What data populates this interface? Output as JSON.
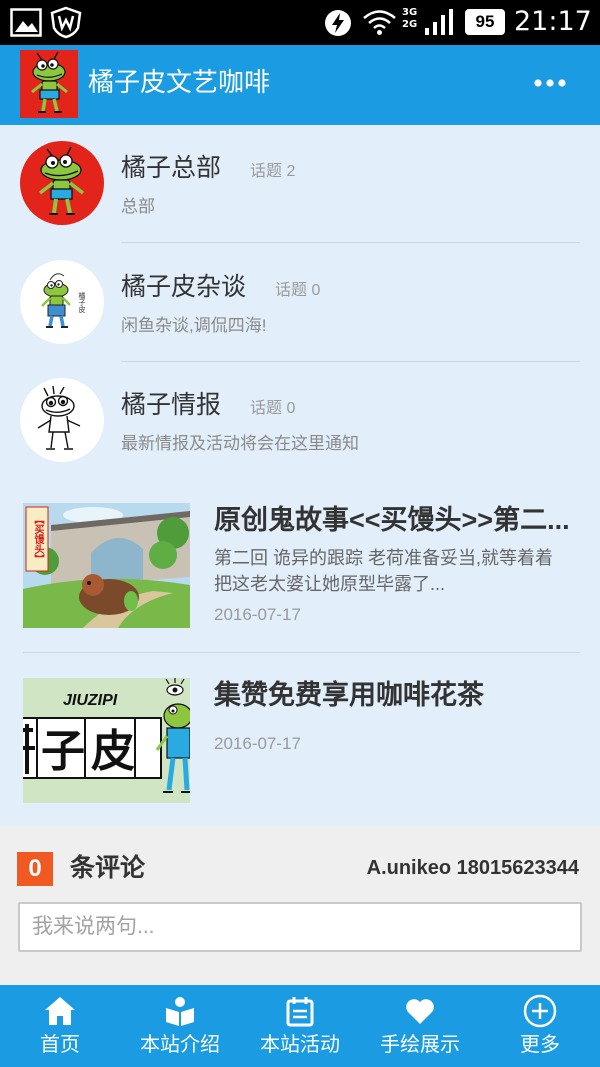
{
  "status_bar": {
    "time": "21:17",
    "battery_level": "95",
    "network_primary": "3G",
    "network_secondary": "2G",
    "icons": [
      "gallery-icon",
      "shield-icon",
      "flash-icon",
      "wifi-icon",
      "signal-icon",
      "battery-icon"
    ]
  },
  "header": {
    "title": "橘子皮文艺咖啡",
    "menu_icon": "more-icon"
  },
  "forums": [
    {
      "name": "橘子总部",
      "topics": "话题 2",
      "description": "总部"
    },
    {
      "name": "橘子皮杂谈",
      "topics": "话题 0",
      "description": "闲鱼杂谈,调侃四海!",
      "avatar_text": "橘子皮"
    },
    {
      "name": "橘子情报",
      "topics": "话题 0",
      "description": "最新情报及活动将会在这里通知"
    }
  ],
  "articles": [
    {
      "title": "原创鬼故事<<买馒头>>第二...",
      "excerpt": "第二回 诡异的跟踪 老荷准备妥当,就等着着把这老太婆让她原型毕露了...",
      "date": "2016-07-17",
      "image_text": "【买馒头】"
    },
    {
      "title": "集赞免费享用咖啡花茶",
      "date": "2016-07-17",
      "image_text": "JIUZIPI",
      "image_chars": "子皮"
    }
  ],
  "comments": {
    "count": "0",
    "label": "条评论",
    "user": "A.unikeo 18015623344",
    "input_placeholder": "我来说两句..."
  },
  "nav": [
    {
      "label": "首页",
      "icon": "home-icon"
    },
    {
      "label": "本站介绍",
      "icon": "book-icon"
    },
    {
      "label": "本站活动",
      "icon": "calendar-icon"
    },
    {
      "label": "手绘展示",
      "icon": "heart-icon"
    },
    {
      "label": "更多",
      "icon": "plus-circle-icon"
    }
  ],
  "colors": {
    "primary": "#1a9be2",
    "content_bg": "#e2effb",
    "comment_bg": "#efefef",
    "badge": "#f05a22",
    "status_bar": "#000000"
  }
}
